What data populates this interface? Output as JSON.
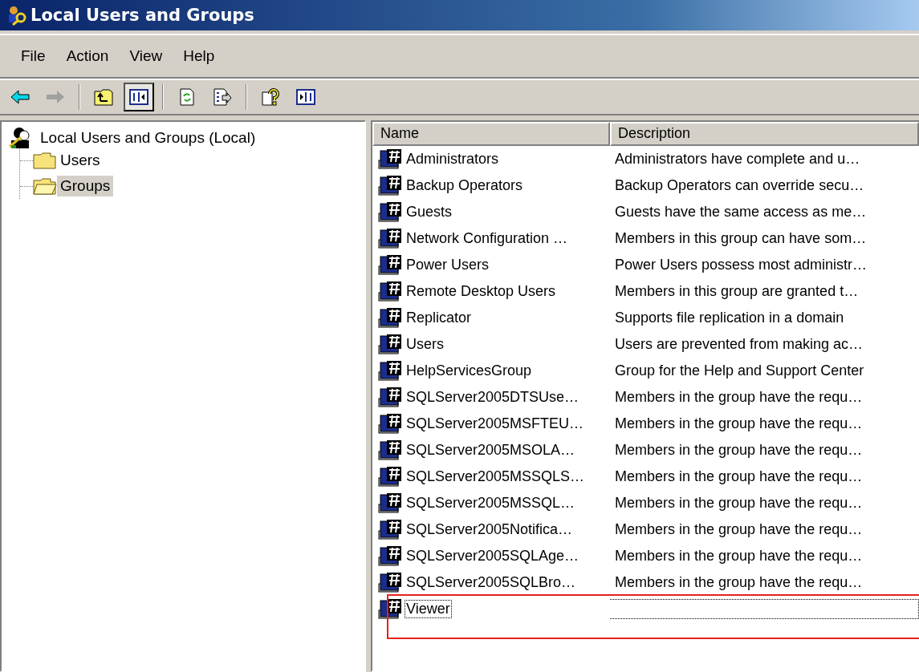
{
  "window": {
    "title": "Local Users and Groups"
  },
  "menu": [
    "File",
    "Action",
    "View",
    "Help"
  ],
  "toolbar": [
    {
      "kind": "back",
      "pressed": false
    },
    {
      "kind": "forward",
      "pressed": false
    },
    {
      "kind": "separator"
    },
    {
      "kind": "up",
      "pressed": false
    },
    {
      "kind": "tree",
      "pressed": true
    },
    {
      "kind": "separator"
    },
    {
      "kind": "refresh",
      "pressed": false
    },
    {
      "kind": "export",
      "pressed": false
    },
    {
      "kind": "separator"
    },
    {
      "kind": "help",
      "pressed": false
    },
    {
      "kind": "pane",
      "pressed": false
    }
  ],
  "tree": {
    "label": "Local Users and Groups (Local)",
    "children": [
      {
        "label": "Users",
        "selected": false
      },
      {
        "label": "Groups",
        "selected": true
      }
    ]
  },
  "table": {
    "columns": [
      "Name",
      "Description"
    ],
    "rows": [
      {
        "name": "Administrators",
        "description": "Administrators have complete and u…",
        "focused": false,
        "annotated": false
      },
      {
        "name": "Backup Operators",
        "description": "Backup Operators can override secu…",
        "focused": false,
        "annotated": false
      },
      {
        "name": "Guests",
        "description": "Guests have the same access as me…",
        "focused": false,
        "annotated": false
      },
      {
        "name": "Network Configuration …",
        "description": "Members in this group can have som…",
        "focused": false,
        "annotated": false
      },
      {
        "name": "Power Users",
        "description": "Power Users possess most administr…",
        "focused": false,
        "annotated": false
      },
      {
        "name": "Remote Desktop Users",
        "description": "Members in this group are granted t…",
        "focused": false,
        "annotated": false
      },
      {
        "name": "Replicator",
        "description": "Supports file replication in a domain",
        "focused": false,
        "annotated": false
      },
      {
        "name": "Users",
        "description": "Users are prevented from making ac…",
        "focused": false,
        "annotated": false
      },
      {
        "name": "HelpServicesGroup",
        "description": "Group for the Help and Support Center",
        "focused": false,
        "annotated": false
      },
      {
        "name": "SQLServer2005DTSUse…",
        "description": "Members in the group have the requ…",
        "focused": false,
        "annotated": false
      },
      {
        "name": "SQLServer2005MSFTEU…",
        "description": "Members in the group have the requ…",
        "focused": false,
        "annotated": false
      },
      {
        "name": "SQLServer2005MSOLA…",
        "description": "Members in the group have the requ…",
        "focused": false,
        "annotated": false
      },
      {
        "name": "SQLServer2005MSSQLS…",
        "description": "Members in the group have the requ…",
        "focused": false,
        "annotated": false
      },
      {
        "name": "SQLServer2005MSSQL…",
        "description": "Members in the group have the requ…",
        "focused": false,
        "annotated": false
      },
      {
        "name": "SQLServer2005Notifica…",
        "description": "Members in the group have the requ…",
        "focused": false,
        "annotated": false
      },
      {
        "name": "SQLServer2005SQLAge…",
        "description": "Members in the group have the requ…",
        "focused": false,
        "annotated": false
      },
      {
        "name": "SQLServer2005SQLBro…",
        "description": "Members in the group have the requ…",
        "focused": false,
        "annotated": false
      },
      {
        "name": "Viewer",
        "description": "",
        "focused": true,
        "annotated": true
      }
    ]
  }
}
